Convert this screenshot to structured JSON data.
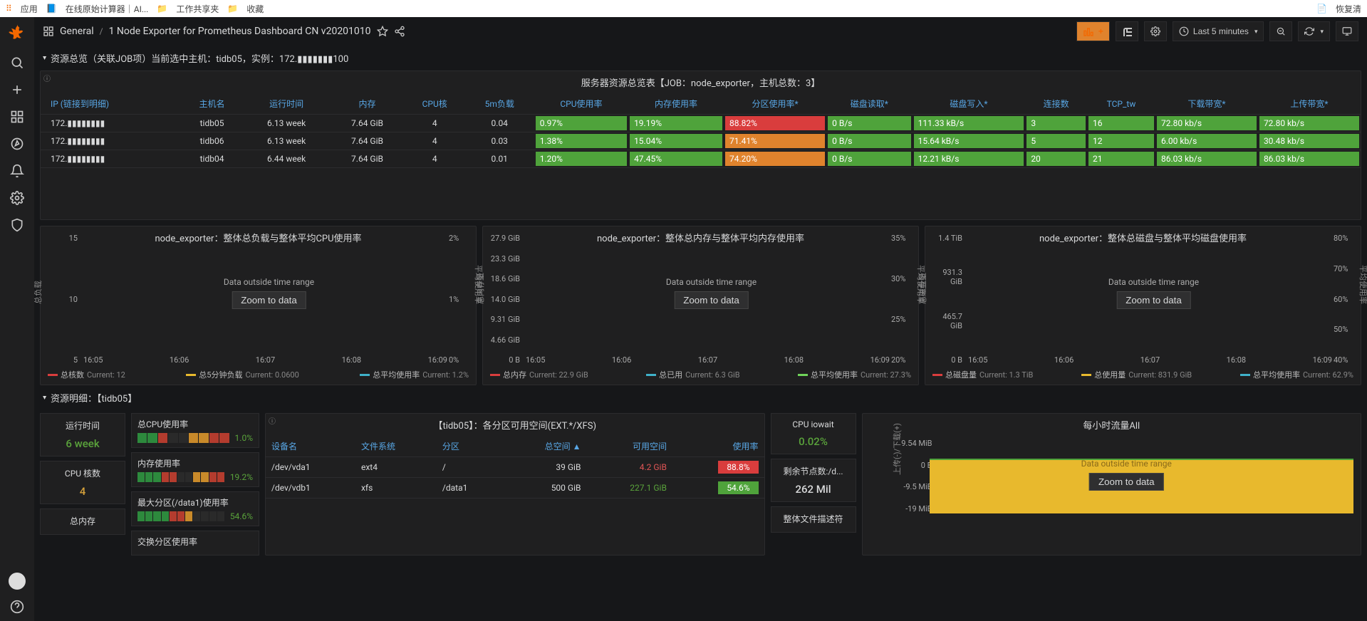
{
  "topbar": {
    "app": "应用",
    "calc": "在线原始计算器｜AI...",
    "work": "工作共享夹",
    "coll": "收藏",
    "clear": "恢复清"
  },
  "breadcrumb": {
    "icon": "dashboard",
    "folder": "General",
    "title": "1 Node Exporter for Prometheus Dashboard CN v20201010"
  },
  "toolbar": {
    "timerange": "Last 5 minutes"
  },
  "row1": {
    "title": "资源总览（关联JOB项）当前选中主机：tidb05，实例：172.▮▮▮▮▮▮▮100"
  },
  "overview": {
    "title": "服务器资源总览表【JOB：node_exporter，主机总数：3】",
    "cols": [
      "IP (链接到明细)",
      "主机名",
      "运行时间",
      "内存",
      "CPU核",
      "5m负载",
      "CPU使用率",
      "内存使用率",
      "分区使用率*",
      "磁盘读取*",
      "磁盘写入*",
      "连接数",
      "TCP_tw",
      "下载带宽*",
      "上传带宽*"
    ],
    "rows": [
      {
        "ip": "172.▮▮▮▮▮▮▮▮",
        "host": "tidb05",
        "uptime": "6.13 week",
        "mem": "7.64 GiB",
        "cpu": "4",
        "load": "0.04",
        "cpu_use": {
          "v": "0.97%",
          "c": "green"
        },
        "mem_use": {
          "v": "19.19%",
          "c": "green"
        },
        "disk_use": {
          "v": "88.82%",
          "c": "red"
        },
        "dr": {
          "v": "0 B/s",
          "c": "green"
        },
        "dw": {
          "v": "111.33 kB/s",
          "c": "green"
        },
        "conn": {
          "v": "3",
          "c": "green"
        },
        "tcp": {
          "v": "16",
          "c": "green"
        },
        "dl": {
          "v": "72.80 kb/s",
          "c": "green"
        },
        "ul": {
          "v": "72.80 kb/s",
          "c": "green"
        }
      },
      {
        "ip": "172.▮▮▮▮▮▮▮▮",
        "host": "tidb06",
        "uptime": "6.13 week",
        "mem": "7.64 GiB",
        "cpu": "4",
        "load": "0.03",
        "cpu_use": {
          "v": "1.38%",
          "c": "green"
        },
        "mem_use": {
          "v": "15.04%",
          "c": "green"
        },
        "disk_use": {
          "v": "71.41%",
          "c": "orange"
        },
        "dr": {
          "v": "0 B/s",
          "c": "green"
        },
        "dw": {
          "v": "15.64 kB/s",
          "c": "green"
        },
        "conn": {
          "v": "5",
          "c": "green"
        },
        "tcp": {
          "v": "12",
          "c": "green"
        },
        "dl": {
          "v": "6.00 kb/s",
          "c": "green"
        },
        "ul": {
          "v": "30.48 kb/s",
          "c": "green"
        }
      },
      {
        "ip": "172.▮▮▮▮▮▮▮▮",
        "host": "tidb04",
        "uptime": "6.44 week",
        "mem": "7.64 GiB",
        "cpu": "4",
        "load": "0.01",
        "cpu_use": {
          "v": "1.20%",
          "c": "green"
        },
        "mem_use": {
          "v": "47.45%",
          "c": "green"
        },
        "disk_use": {
          "v": "74.20%",
          "c": "orange"
        },
        "dr": {
          "v": "0 B/s",
          "c": "green"
        },
        "dw": {
          "v": "12.21 kB/s",
          "c": "green"
        },
        "conn": {
          "v": "20",
          "c": "green"
        },
        "tcp": {
          "v": "21",
          "c": "green"
        },
        "dl": {
          "v": "86.03 kb/s",
          "c": "green"
        },
        "ul": {
          "v": "86.03 kb/s",
          "c": "green"
        }
      }
    ]
  },
  "charts": [
    {
      "title": "node_exporter：整体总负载与整体平均CPU使用率",
      "yl": [
        "15",
        "10",
        "5"
      ],
      "yr": [
        "2%",
        "1%",
        "0%"
      ],
      "xl": [
        "16:05",
        "16:06",
        "16:07",
        "16:08",
        "16:09"
      ],
      "ylabel": "总负载",
      "ylabel2": "平均使用率",
      "notice": "Data outside time range",
      "zoom": "Zoom to data",
      "legend": [
        {
          "c": "#d93d3d",
          "n": "总核数",
          "v": "Current: 12"
        },
        {
          "c": "#e8b92d",
          "n": "总5分钟负载",
          "v": "Current: 0.0600"
        },
        {
          "c": "#3fb1c9",
          "n": "总平均使用率",
          "v": "Current: 1.2%"
        }
      ]
    },
    {
      "title": "node_exporter：整体总内存与整体平均内存使用率",
      "yl": [
        "27.9 GiB",
        "23.3 GiB",
        "18.6 GiB",
        "14.0 GiB",
        "9.31 GiB",
        "4.66 GiB",
        "0 B"
      ],
      "yr": [
        "35%",
        "30%",
        "25%",
        "20%"
      ],
      "xl": [
        "16:05",
        "16:06",
        "16:07",
        "16:08",
        "16:09"
      ],
      "ylabel": "总内存量",
      "ylabel2": "平均使用率",
      "notice": "Data outside time range",
      "zoom": "Zoom to data",
      "legend": [
        {
          "c": "#d93d3d",
          "n": "总内存",
          "v": "Current: 22.9 GiB"
        },
        {
          "c": "#3fb1c9",
          "n": "总已用",
          "v": "Current: 6.3 GiB"
        },
        {
          "c": "#6fd35a",
          "n": "总平均使用率",
          "v": "Current: 27.3%"
        }
      ]
    },
    {
      "title": "node_exporter：整体总磁盘与整体平均磁盘使用率",
      "yl": [
        "1.4 TiB",
        "931.3 GiB",
        "465.7 GiB",
        "0 B"
      ],
      "yr": [
        "80%",
        "70%",
        "60%",
        "50%",
        "40%"
      ],
      "xl": [
        "16:05",
        "16:06",
        "16:07",
        "16:08",
        "16:09"
      ],
      "ylabel": "总磁盘量",
      "ylabel2": "平均使用率",
      "notice": "Data outside time range",
      "zoom": "Zoom to data",
      "legend": [
        {
          "c": "#d93d3d",
          "n": "总磁盘量",
          "v": "Current: 1.3 TiB"
        },
        {
          "c": "#e8b92d",
          "n": "总使用量",
          "v": "Current: 831.9 GiB"
        },
        {
          "c": "#3fb1c9",
          "n": "总平均使用率",
          "v": "Current: 62.9%"
        }
      ]
    }
  ],
  "row2": {
    "title": "资源明细：【tidb05】"
  },
  "stats": {
    "uptime": {
      "lbl": "运行时间",
      "val": "6 week",
      "col": "#5aa33b"
    },
    "cores": {
      "lbl": "CPU 核数",
      "val": "4",
      "col": "#d8a33b"
    },
    "totalmem": {
      "lbl": "总内存"
    }
  },
  "bars": [
    {
      "lbl": "总CPU使用率",
      "pct": "1.0%",
      "segs": [
        3,
        3,
        2,
        0,
        0,
        1,
        1,
        2,
        2
      ]
    },
    {
      "lbl": "内存使用率",
      "pct": "19.2%",
      "segs": [
        3,
        3,
        3,
        2,
        2,
        0,
        0,
        1,
        1,
        2,
        2
      ]
    },
    {
      "lbl": "最大分区(/data1)使用率",
      "pct": "54.6%",
      "segs": [
        3,
        3,
        3,
        3,
        2,
        2,
        1,
        0,
        0,
        0,
        0
      ]
    },
    {
      "lbl": "交换分区使用率"
    }
  ],
  "disks": {
    "title": "【tidb05】：各分区可用空间(EXT.*/XFS)",
    "cols": [
      "设备名",
      "文件系统",
      "分区",
      "总空间 ▲",
      "可用空间",
      "使用率"
    ],
    "rows": [
      {
        "dev": "/dev/vda1",
        "fs": "ext4",
        "mnt": "/",
        "tot": "39 GiB",
        "free": "4.2 GiB",
        "freec": "redtxt",
        "use": "88.8%",
        "usec": "red"
      },
      {
        "dev": "/dev/vdb1",
        "fs": "xfs",
        "mnt": "/data1",
        "tot": "500 GiB",
        "free": "227.1 GiB",
        "freec": "grntxt",
        "use": "54.6%",
        "usec": "green"
      }
    ]
  },
  "iowait": {
    "lbl": "CPU iowait",
    "val": "0.02%",
    "col": "#5aa33b"
  },
  "remain": {
    "lbl": "剩余节点数:/d...",
    "val": "262 Mil"
  },
  "descr": {
    "lbl": "整体文件描述符"
  },
  "flow": {
    "title": "每小时流量All",
    "yl": [
      "9.54 MiB",
      "0 B",
      "-9.5 MiB",
      "-19 MiB"
    ],
    "ylabel": "上传(-)/下载(+)",
    "notice": "Data outside time range",
    "zoom": "Zoom to data"
  }
}
